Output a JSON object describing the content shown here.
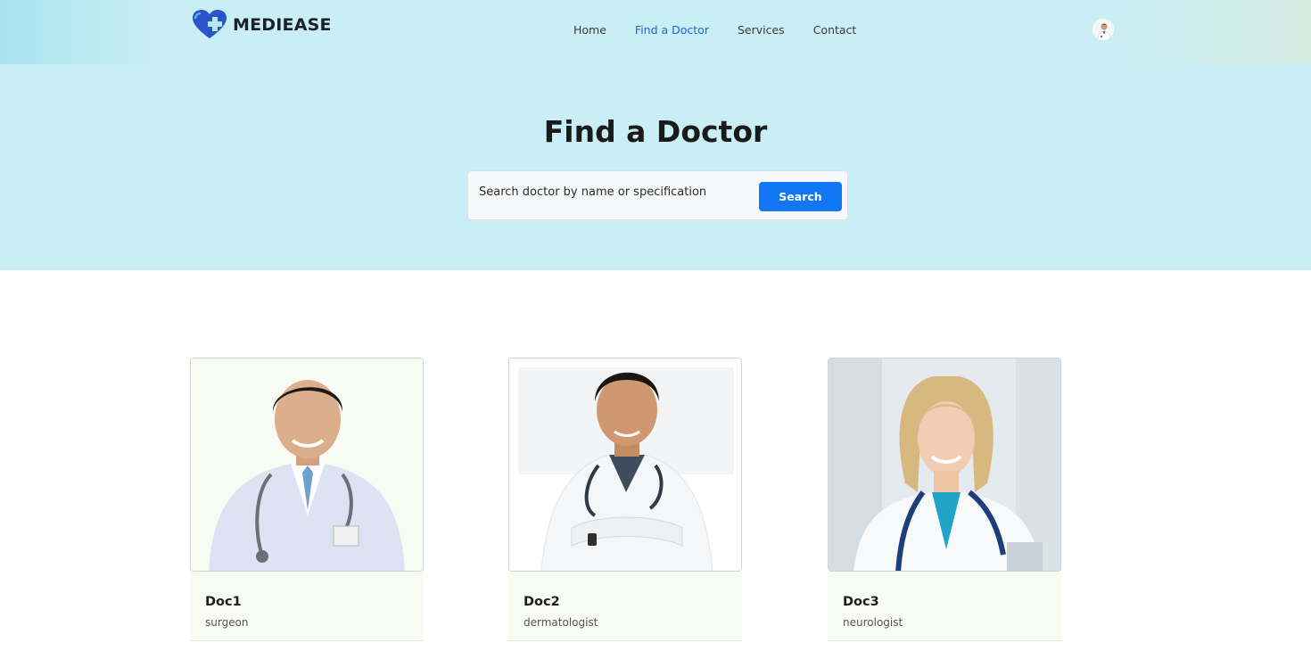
{
  "brand": {
    "name": "MEDIEASE",
    "primary_color": "#1177f5",
    "logo_color": "#2a55c8"
  },
  "nav": {
    "links": [
      {
        "label": "Home",
        "active": false
      },
      {
        "label": "Find a Doctor",
        "active": true
      },
      {
        "label": "Services",
        "active": false
      },
      {
        "label": "Contact",
        "active": false
      }
    ],
    "avatar_icon": "user-avatar"
  },
  "hero": {
    "title": "Find a Doctor",
    "search": {
      "placeholder": "Search doctor by name or specification",
      "value": "",
      "button_label": "Search"
    }
  },
  "doctors": [
    {
      "name": "Doc1",
      "specialty": "surgeon"
    },
    {
      "name": "Doc2",
      "specialty": "dermatologist"
    },
    {
      "name": "Doc3",
      "specialty": "neurologist"
    }
  ]
}
